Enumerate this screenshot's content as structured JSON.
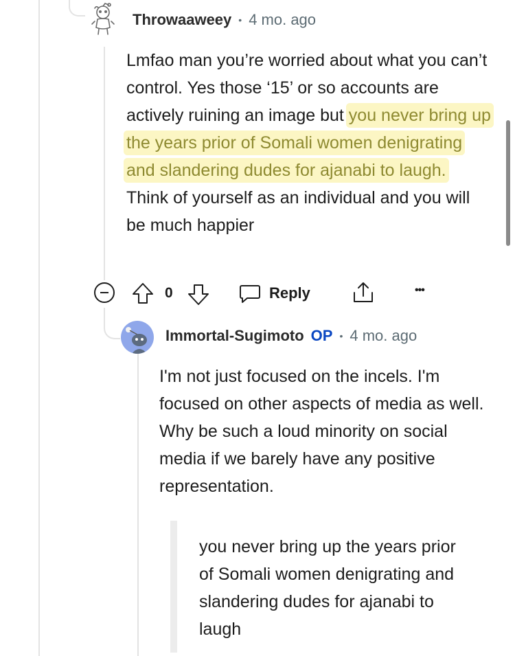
{
  "comment1": {
    "username": "Throwaaweey",
    "separator": "•",
    "time": "4 mo. ago",
    "text_before": "Lmfao man you’re worried about what you can’t control. Yes those ‘15’ or so accounts are actively ruining an image but ",
    "text_highlight": "you never bring up the years prior of Somali women denigrating and slandering dudes for ajanabi to laugh.",
    "text_after": " Think of yourself as an individual and you will be much happier",
    "highlight_color": "#fcf6c4",
    "highlight_text_color": "#8e8a31"
  },
  "actions": {
    "collapse_icon": "minus-circle-icon",
    "upvote_icon": "arrow-up-icon",
    "vote_count": "0",
    "downvote_icon": "arrow-down-icon",
    "reply_icon": "speech-bubble-icon",
    "reply_label": "Reply",
    "share_icon": "share-upload-icon",
    "more_label": "•••"
  },
  "comment2": {
    "username": "Immortal-Sugimoto",
    "op_badge": "OP",
    "separator": "•",
    "time": "4 mo. ago",
    "text": "I'm not just focused on the incels. I'm focused on other aspects of media as well. Why be such a loud minority on social media if we barely have any positive representation.",
    "quote": "you never bring up the years prior of Somali women denigrating and slandering dudes for ajanabi to laugh",
    "avatar_color": "#8fa7ea",
    "op_color": "#0a47c2"
  }
}
